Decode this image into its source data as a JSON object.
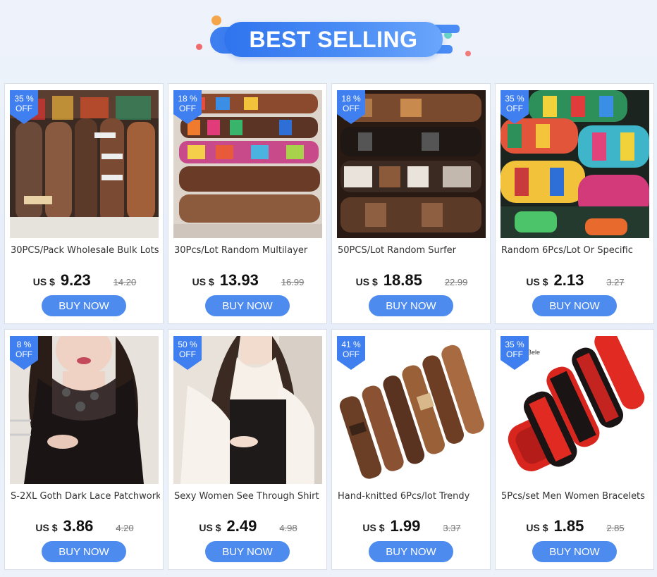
{
  "header": {
    "title": "BEST SELLING"
  },
  "colors": {
    "accent": "#4d8bef",
    "badge": "#3f7ff0",
    "banner": "#2f74ee"
  },
  "products": [
    {
      "discount": "35 %",
      "off": "OFF",
      "title": "30PCS/Pack Wholesale Bulk Lots",
      "currency": "US $",
      "price": "9.23",
      "old_price": "14.20",
      "buy": "BUY NOW",
      "image": "leather-bracelets-pile"
    },
    {
      "discount": "18 %",
      "off": "OFF",
      "title": "30Pcs/Lot Random Multilayer",
      "currency": "US $",
      "price": "13.93",
      "old_price": "16.99",
      "buy": "BUY NOW",
      "image": "multilayer-bracelets"
    },
    {
      "discount": "18 %",
      "off": "OFF",
      "title": "50PCS/Lot Random Surfer",
      "currency": "US $",
      "price": "18.85",
      "old_price": "22.99",
      "buy": "BUY NOW",
      "image": "surfer-bracelets"
    },
    {
      "discount": "35 %",
      "off": "OFF",
      "title": "Random 6Pcs/Lot Or Specific",
      "currency": "US $",
      "price": "2.13",
      "old_price": "3.27",
      "buy": "BUY NOW",
      "image": "colorful-woven-bracelets"
    },
    {
      "discount": "8 %",
      "off": "OFF",
      "title": "S-2XL Goth Dark Lace Patchwork",
      "currency": "US $",
      "price": "3.86",
      "old_price": "4.20",
      "buy": "BUY NOW",
      "image": "lace-top-model"
    },
    {
      "discount": "50 %",
      "off": "OFF",
      "title": "Sexy Women See Through Shirt",
      "currency": "US $",
      "price": "2.49",
      "old_price": "4.98",
      "buy": "BUY NOW",
      "image": "see-through-shirt-model"
    },
    {
      "discount": "41 %",
      "off": "OFF",
      "title": "Hand-knitted 6Pcs/lot Trendy",
      "currency": "US $",
      "price": "1.99",
      "old_price": "3.37",
      "buy": "BUY NOW",
      "image": "brown-leather-bracelets"
    },
    {
      "discount": "35 %",
      "off": "OFF",
      "title": "5Pcs/set Men Women Bracelets",
      "currency": "US $",
      "price": "1.85",
      "old_price": "2.85",
      "buy": "BUY NOW",
      "image": "red-black-bracelets",
      "image_text": "Bele"
    }
  ]
}
